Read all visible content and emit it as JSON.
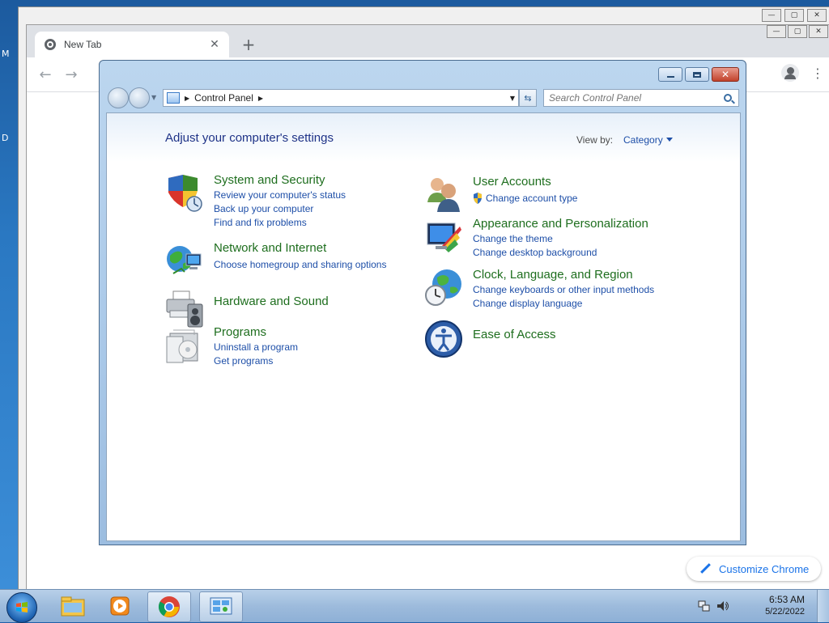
{
  "desktop": {
    "left_letters": [
      "M",
      "D"
    ]
  },
  "chrome": {
    "tab_title": "New Tab",
    "new_tab_symbol": "+",
    "close_symbol": "✕",
    "back_symbol": "←",
    "forward_symbol": "→",
    "menu_symbol": "⋮",
    "customize_label": "Customize Chrome"
  },
  "control_panel": {
    "breadcrumb": "Control Panel",
    "search_placeholder": "Search Control Panel",
    "heading": "Adjust your computer's settings",
    "view_by_label": "View by:",
    "view_by_value": "Category",
    "categories_left": [
      {
        "title": "System and Security",
        "icon": "shield-icon",
        "links": [
          "Review your computer's status",
          "Back up your computer",
          "Find and fix problems"
        ]
      },
      {
        "title": "Network and Internet",
        "icon": "network-icon",
        "links": [
          "Choose homegroup and sharing options"
        ]
      },
      {
        "title": "Hardware and Sound",
        "icon": "printer-icon",
        "links": []
      },
      {
        "title": "Programs",
        "icon": "programs-icon",
        "links": [
          "Uninstall a program",
          "Get programs"
        ]
      }
    ],
    "categories_right": [
      {
        "title": "User Accounts",
        "icon": "users-icon",
        "links": [
          "Change account type"
        ]
      },
      {
        "title": "Appearance and Personalization",
        "icon": "appearance-icon",
        "links": [
          "Change the theme",
          "Change desktop background"
        ]
      },
      {
        "title": "Clock, Language, and Region",
        "icon": "clock-globe-icon",
        "links": [
          "Change keyboards or other input methods",
          "Change display language"
        ]
      },
      {
        "title": "Ease of Access",
        "icon": "ease-of-access-icon",
        "links": []
      }
    ]
  },
  "taskbar": {
    "items": [
      "file-explorer-icon",
      "media-player-icon",
      "chrome-icon",
      "control-panel-icon"
    ],
    "time": "6:53 AM",
    "date": "5/22/2022"
  }
}
